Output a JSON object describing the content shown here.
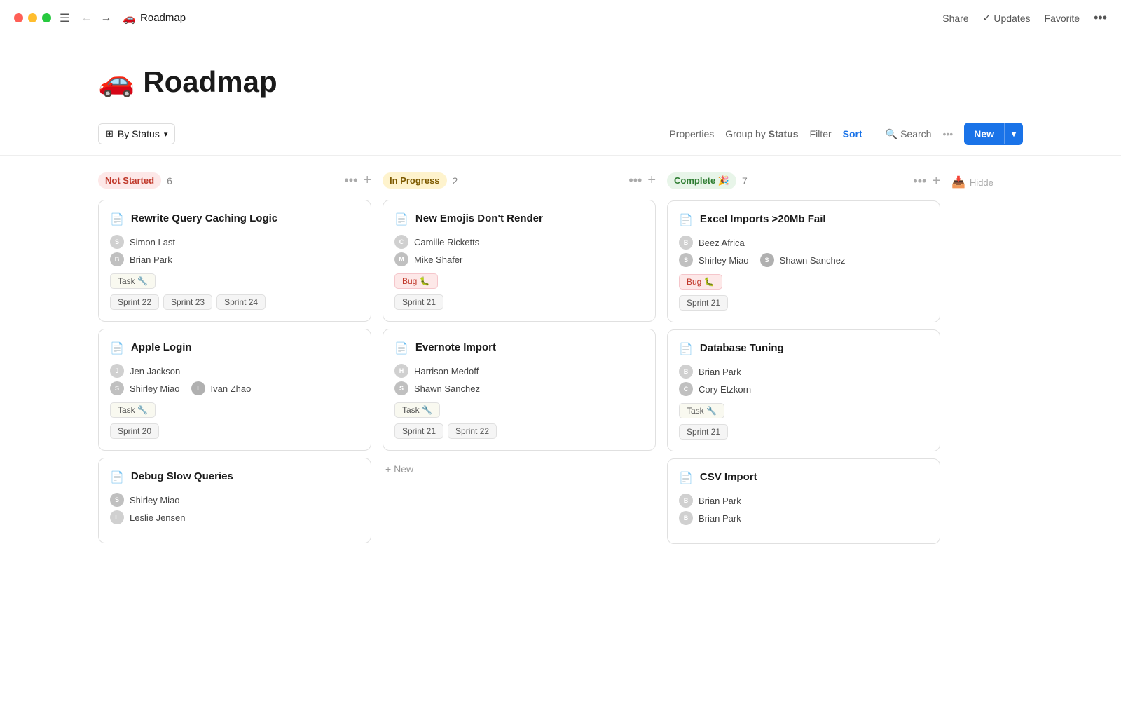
{
  "titlebar": {
    "title": "Roadmap",
    "emoji": "🚗",
    "share": "Share",
    "updates": "Updates",
    "favorite": "Favorite"
  },
  "page": {
    "emoji": "🚗",
    "title": "Roadmap"
  },
  "toolbar": {
    "byStatus": "By Status",
    "properties": "Properties",
    "groupBy": "Group by",
    "groupByValue": "Status",
    "filter": "Filter",
    "sort": "Sort",
    "search": "Search",
    "new": "New"
  },
  "columns": [
    {
      "id": "not-started",
      "label": "Not Started",
      "count": "6",
      "statusClass": "status-not-started",
      "cards": [
        {
          "title": "Rewrite Query Caching Logic",
          "assignees": [
            {
              "name": "Simon Last",
              "avatarBg": "#d0d0d0"
            },
            {
              "name": "Brian Park",
              "avatarBg": "#c0c0c0"
            }
          ],
          "tag": "Task 🔧",
          "tagClass": "tag",
          "sprints": [
            "Sprint 22",
            "Sprint 23",
            "Sprint 24"
          ]
        },
        {
          "title": "Apple Login",
          "assignees": [
            {
              "name": "Jen Jackson",
              "avatarBg": "#d0d0d0"
            },
            {
              "name": "Shirley Miao",
              "avatarBg": "#c0c0c0"
            },
            {
              "name": "Ivan Zhao",
              "avatarBg": "#b0b0b0"
            }
          ],
          "tag": "Task 🔧",
          "tagClass": "tag",
          "sprints": [
            "Sprint 20"
          ]
        },
        {
          "title": "Debug Slow Queries",
          "assignees": [
            {
              "name": "Shirley Miao",
              "avatarBg": "#c0c0c0"
            },
            {
              "name": "Leslie Jensen",
              "avatarBg": "#d0d0d0"
            }
          ],
          "tag": null,
          "sprints": []
        }
      ]
    },
    {
      "id": "in-progress",
      "label": "In Progress",
      "count": "2",
      "statusClass": "status-in-progress",
      "cards": [
        {
          "title": "New Emojis Don't Render",
          "assignees": [
            {
              "name": "Camille Ricketts",
              "avatarBg": "#d0d0d0"
            },
            {
              "name": "Mike Shafer",
              "avatarBg": "#c0c0c0"
            }
          ],
          "tag": "Bug 🐛",
          "tagClass": "tag-bug",
          "sprints": [
            "Sprint 21"
          ]
        },
        {
          "title": "Evernote Import",
          "assignees": [
            {
              "name": "Harrison Medoff",
              "avatarBg": "#d0d0d0"
            },
            {
              "name": "Shawn Sanchez",
              "avatarBg": "#c0c0c0"
            }
          ],
          "tag": "Task 🔧",
          "tagClass": "tag",
          "sprints": [
            "Sprint 21",
            "Sprint 22"
          ]
        }
      ],
      "addNew": true
    },
    {
      "id": "complete",
      "label": "Complete 🎉",
      "count": "7",
      "statusClass": "status-complete",
      "cards": [
        {
          "title": "Excel Imports >20Mb Fail",
          "assignees": [
            {
              "name": "Beez Africa",
              "avatarBg": "#d0d0d0"
            },
            {
              "name": "Shirley Miao",
              "avatarBg": "#c0c0c0"
            },
            {
              "name": "Shawn Sanchez",
              "avatarBg": "#b0b0b0"
            }
          ],
          "tag": "Bug 🐛",
          "tagClass": "tag-bug",
          "sprints": [
            "Sprint 21"
          ]
        },
        {
          "title": "Database Tuning",
          "assignees": [
            {
              "name": "Brian Park",
              "avatarBg": "#d0d0d0"
            },
            {
              "name": "Cory Etzkorn",
              "avatarBg": "#c0c0c0"
            }
          ],
          "tag": "Task 🔧",
          "tagClass": "tag",
          "sprints": [
            "Sprint 21"
          ]
        },
        {
          "title": "CSV Import",
          "assignees": [
            {
              "name": "Brian Park",
              "avatarBg": "#d0d0d0"
            },
            {
              "name": "Brian Park",
              "avatarBg": "#d0d0d0"
            }
          ],
          "tag": null,
          "sprints": []
        }
      ]
    }
  ],
  "addNewLabel": "+ New",
  "hiddenLabel": "Hidde"
}
